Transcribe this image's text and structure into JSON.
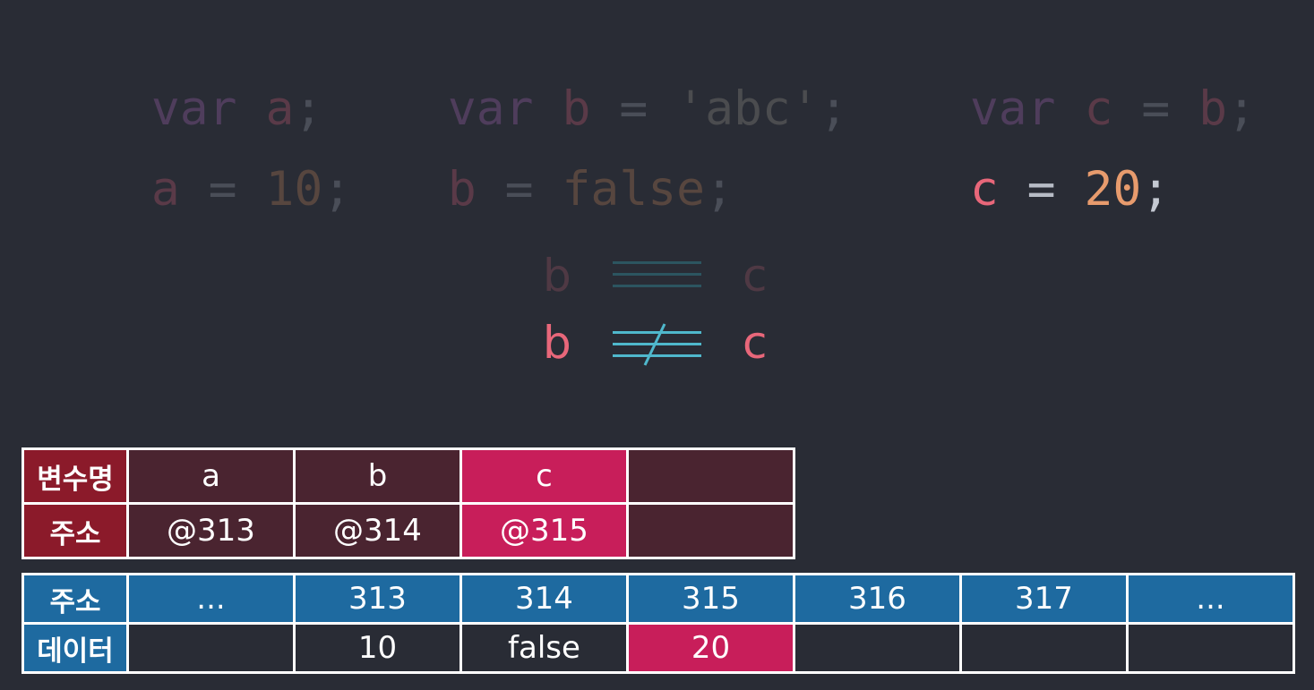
{
  "code": {
    "line1": [
      {
        "kw": "var",
        "name": "a",
        "end": ";"
      },
      {
        "kw": "var",
        "name": "b",
        "op": "=",
        "value": "'abc'",
        "end": ";"
      },
      {
        "kw": "var",
        "name": "c",
        "op": "=",
        "value": "b",
        "end": ";"
      }
    ],
    "line2": [
      {
        "name": "a",
        "op": "=",
        "value": "10",
        "end": ";"
      },
      {
        "name": "b",
        "op": "=",
        "value": "false",
        "end": ";"
      },
      {
        "name": "c",
        "op": "=",
        "value": "20",
        "end": ";"
      }
    ]
  },
  "comparison": {
    "row1": {
      "left": "b",
      "right": "c",
      "relation": "identical"
    },
    "row2": {
      "left": "b",
      "right": "c",
      "relation": "not-identical"
    }
  },
  "variable_table": {
    "header_name": "변수명",
    "header_address": "주소",
    "columns": [
      {
        "name": "a",
        "address": "@313"
      },
      {
        "name": "b",
        "address": "@314"
      },
      {
        "name": "c",
        "address": "@315"
      },
      {
        "name": "",
        "address": ""
      }
    ]
  },
  "memory_table": {
    "header_address": "주소",
    "header_data": "데이터",
    "columns": [
      {
        "address": "...",
        "data": ""
      },
      {
        "address": "313",
        "data": "10"
      },
      {
        "address": "314",
        "data": "false"
      },
      {
        "address": "315",
        "data": "20"
      },
      {
        "address": "316",
        "data": ""
      },
      {
        "address": "317",
        "data": ""
      },
      {
        "address": "...",
        "data": ""
      }
    ]
  },
  "colors": {
    "background": "#292c35",
    "highlight": "#c81e5a",
    "variable_header": "#8b1a2a",
    "memory_header": "#1e6aa0",
    "equal_sign": "#4fb8cc"
  }
}
